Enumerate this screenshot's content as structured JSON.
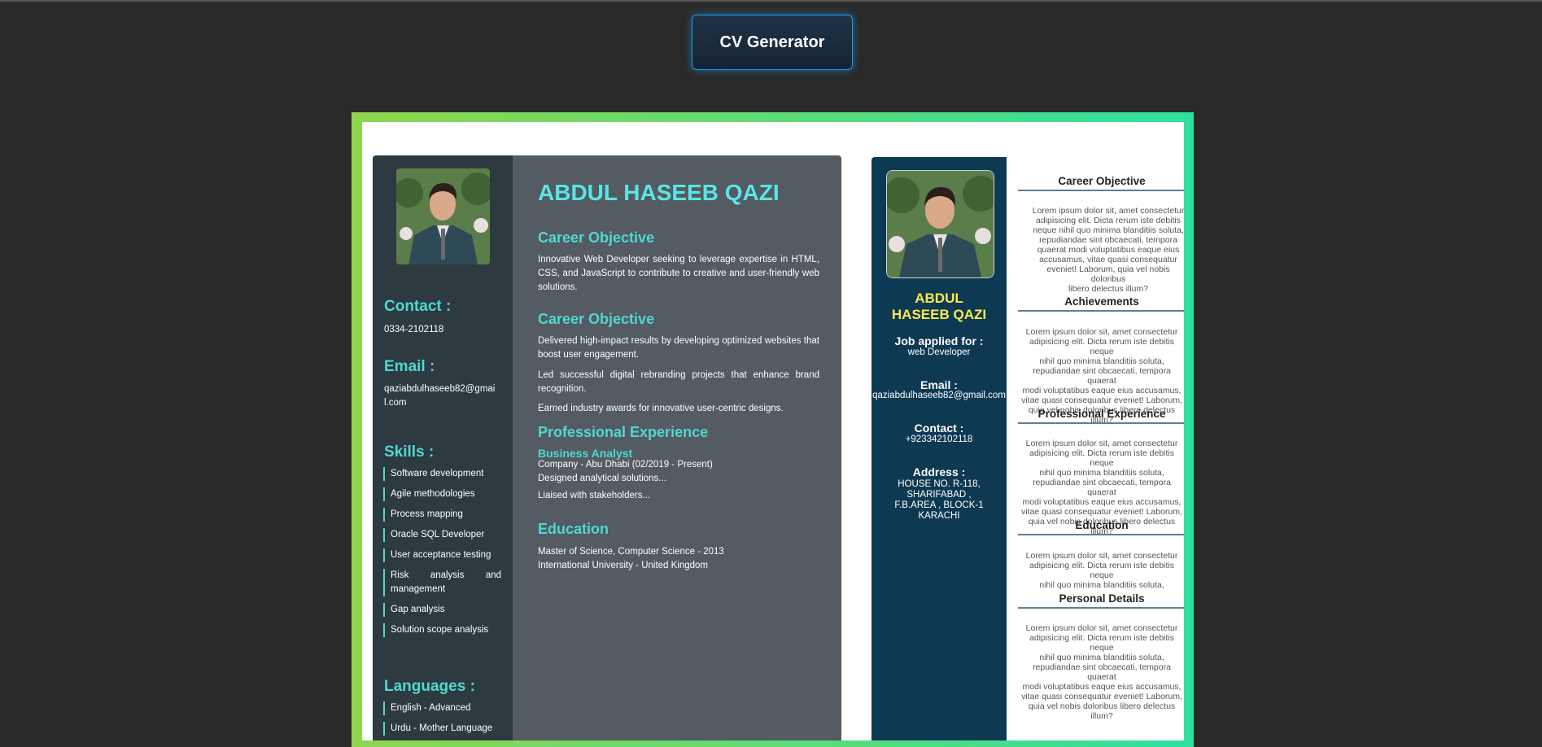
{
  "header": {
    "generator_button_label": "CV Generator"
  },
  "cv1": {
    "sidebar": {
      "contact_heading": "Contact :",
      "contact_value": "0334-2102118",
      "email_heading": "Email :",
      "email_value": "qaziabdulhaseeb82@gmail.com",
      "skills_heading": "Skills :",
      "skills": [
        "Software development",
        "Agile methodologies",
        "Process mapping",
        "Oracle SQL Developer",
        "User acceptance testing",
        "Risk analysis and management",
        "Gap analysis",
        "Solution scope analysis"
      ],
      "languages_heading": "Languages :",
      "languages": [
        "English - Advanced",
        "Urdu - Mother Language"
      ]
    },
    "main": {
      "name": "ABDUL HASEEB QAZI",
      "objective_heading_1": "Career Objective",
      "objective_text_1": "Innovative Web Developer seeking to leverage expertise in HTML, CSS, and JavaScript to contribute to creative and user-friendly web solutions.",
      "objective_heading_2": "Career Objective",
      "achievements": [
        "Delivered high-impact results by developing optimized websites that boost user engagement.",
        "Led successful digital rebranding projects that enhance brand recognition.",
        "Earned industry awards for innovative user-centric designs."
      ],
      "experience_heading": "Professional Experience",
      "job_title": "Business Analyst",
      "job_company": "Company - Abu Dhabi (02/2019 - Present)",
      "job_duty_1": "Designed analytical solutions...",
      "job_duty_2": "Liaised with stakeholders...",
      "education_heading": "Education",
      "education_degree": "Master of Science, Computer Science - 2013",
      "education_school": "International University - United Kingdom"
    }
  },
  "cv2": {
    "sidebar": {
      "name_line_1": "ABDUL",
      "name_line_2": "HASEEB QAZI",
      "job_label": "Job applied for :",
      "job_value": "web Developer",
      "email_label": "Email :",
      "email_value": "qaziabdulhaseeb82@gmail.com",
      "contact_label": "Contact :",
      "contact_value": "+923342102118",
      "address_label": "Address :",
      "address_lines": [
        "HOUSE NO. R-118,",
        "SHARIFABAD ,",
        "F.B.AREA , BLOCK-1",
        "KARACHI"
      ]
    },
    "main": {
      "career_heading": "Career Objective",
      "career_lines": [
        "Lorem ipsum dolor sit, amet consectetur",
        "adipisicing elit. Dicta rerum iste debitis",
        "neque nihil quo minima blanditiis soluta,",
        "repudiandae sint obcaecati, tempora",
        "quaerat modi voluptatibus eaque eius",
        "accusamus, vitae quasi consequatur",
        "eveniet! Laborum, quia vel nobis doloribus",
        "libero delectus illum?"
      ],
      "achievements_heading": "Achievements",
      "achievements_lines": [
        "Lorem ipsum dolor sit, amet consectetur",
        "adipisicing elit. Dicta rerum iste debitis neque",
        "nihil quo minima blanditiis soluta,",
        "repudiandae sint obcaecati, tempora quaerat",
        "modi voluptatibus eaque eius accusamus,",
        "vitae quasi consequatur eveniet! Laborum,",
        "quia vel nobis doloribus libero delectus illum?"
      ],
      "experience_heading": "Professional Experience",
      "experience_lines": [
        "Lorem ipsum dolor sit, amet consectetur",
        "adipisicing elit. Dicta rerum iste debitis neque",
        "nihil quo minima blanditiis soluta,",
        "repudiandae sint obcaecati, tempora quaerat",
        "modi voluptatibus eaque eius accusamus,",
        "vitae quasi consequatur eveniet! Laborum,",
        "quia vel nobis doloribus libero delectus illum?"
      ],
      "education_heading": "Education",
      "education_lines": [
        "Lorem ipsum dolor sit, amet consectetur",
        "adipisicing elit. Dicta rerum iste debitis neque",
        "nihil quo minima blanditiis soluta,"
      ],
      "personal_heading": "Personal Details",
      "personal_lines": [
        "Lorem ipsum dolor sit, amet consectetur",
        "adipisicing elit. Dicta rerum iste debitis neque",
        "nihil quo minima blanditiis soluta,",
        "repudiandae sint obcaecati, tempora quaerat",
        "modi voluptatibus eaque eius accusamus,",
        "vitae quasi consequatur eveniet! Laborum,",
        "quia vel nobis doloribus libero delectus illum?"
      ]
    }
  }
}
